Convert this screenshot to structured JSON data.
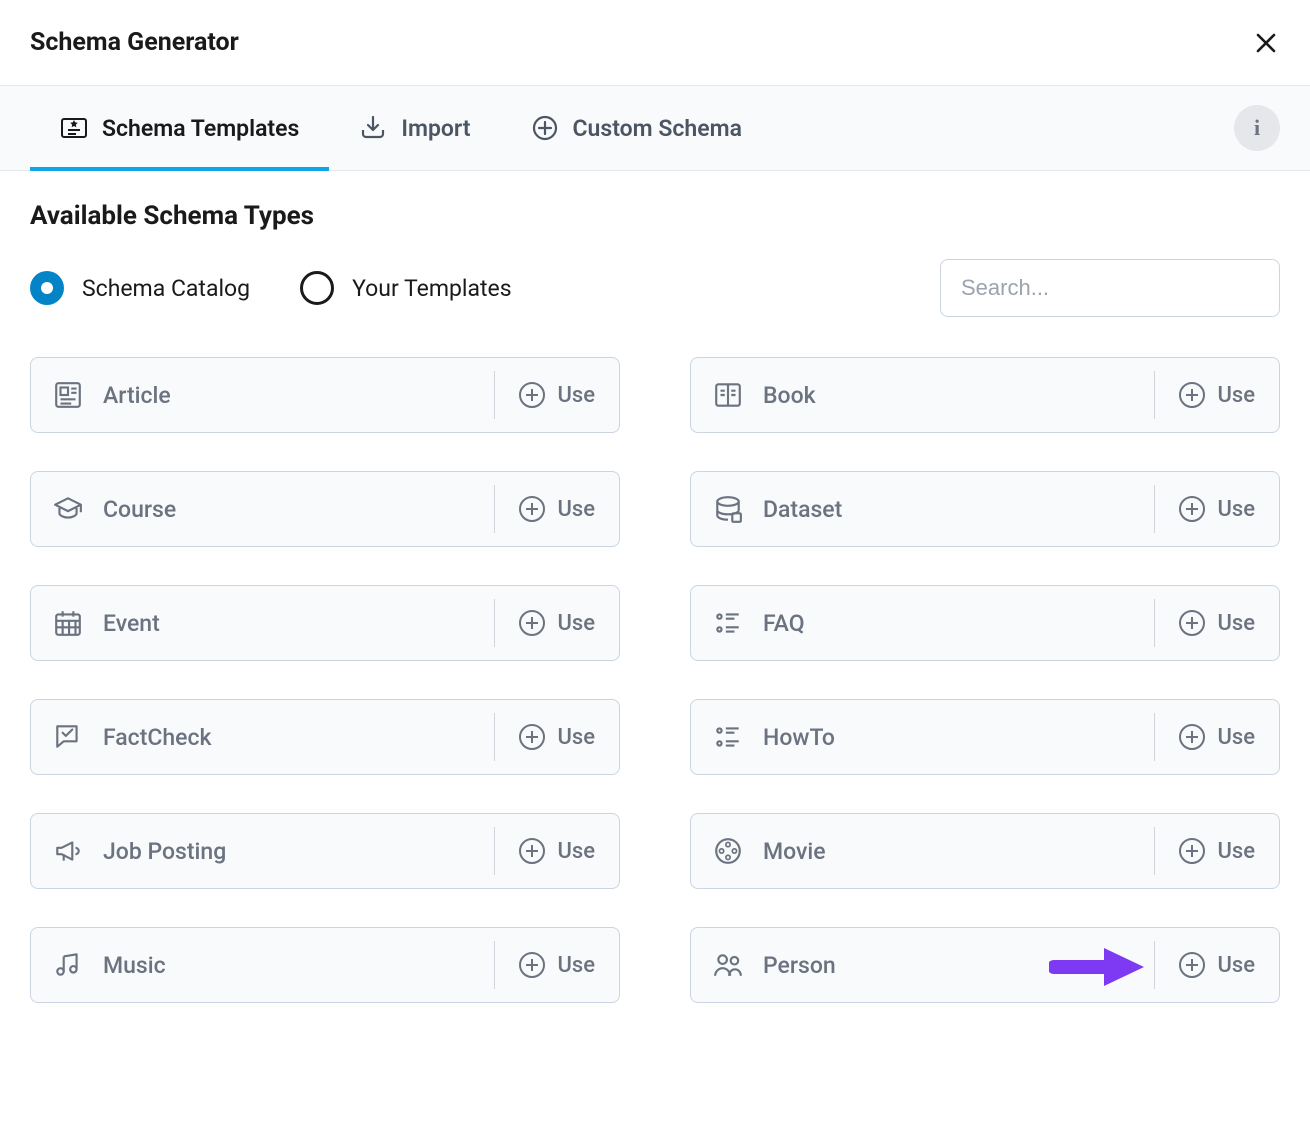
{
  "header": {
    "title": "Schema Generator"
  },
  "tabs": [
    {
      "id": "templates",
      "label": "Schema Templates",
      "active": true
    },
    {
      "id": "import",
      "label": "Import",
      "active": false
    },
    {
      "id": "custom",
      "label": "Custom Schema",
      "active": false
    }
  ],
  "section_title": "Available Schema Types",
  "radios": [
    {
      "id": "catalog",
      "label": "Schema Catalog",
      "selected": true
    },
    {
      "id": "your",
      "label": "Your Templates",
      "selected": false
    }
  ],
  "search": {
    "placeholder": "Search..."
  },
  "use_label": "Use",
  "schema_types": [
    {
      "id": "article",
      "label": "Article",
      "icon": "article-icon"
    },
    {
      "id": "book",
      "label": "Book",
      "icon": "book-icon"
    },
    {
      "id": "course",
      "label": "Course",
      "icon": "course-icon"
    },
    {
      "id": "dataset",
      "label": "Dataset",
      "icon": "dataset-icon"
    },
    {
      "id": "event",
      "label": "Event",
      "icon": "event-icon"
    },
    {
      "id": "faq",
      "label": "FAQ",
      "icon": "list-icon"
    },
    {
      "id": "factcheck",
      "label": "FactCheck",
      "icon": "factcheck-icon"
    },
    {
      "id": "howto",
      "label": "HowTo",
      "icon": "list-icon"
    },
    {
      "id": "jobposting",
      "label": "Job Posting",
      "icon": "megaphone-icon"
    },
    {
      "id": "movie",
      "label": "Movie",
      "icon": "movie-icon"
    },
    {
      "id": "music",
      "label": "Music",
      "icon": "music-icon"
    },
    {
      "id": "person",
      "label": "Person",
      "icon": "person-icon"
    }
  ],
  "annotation": {
    "target_id": "person",
    "color": "#7e3af2"
  }
}
